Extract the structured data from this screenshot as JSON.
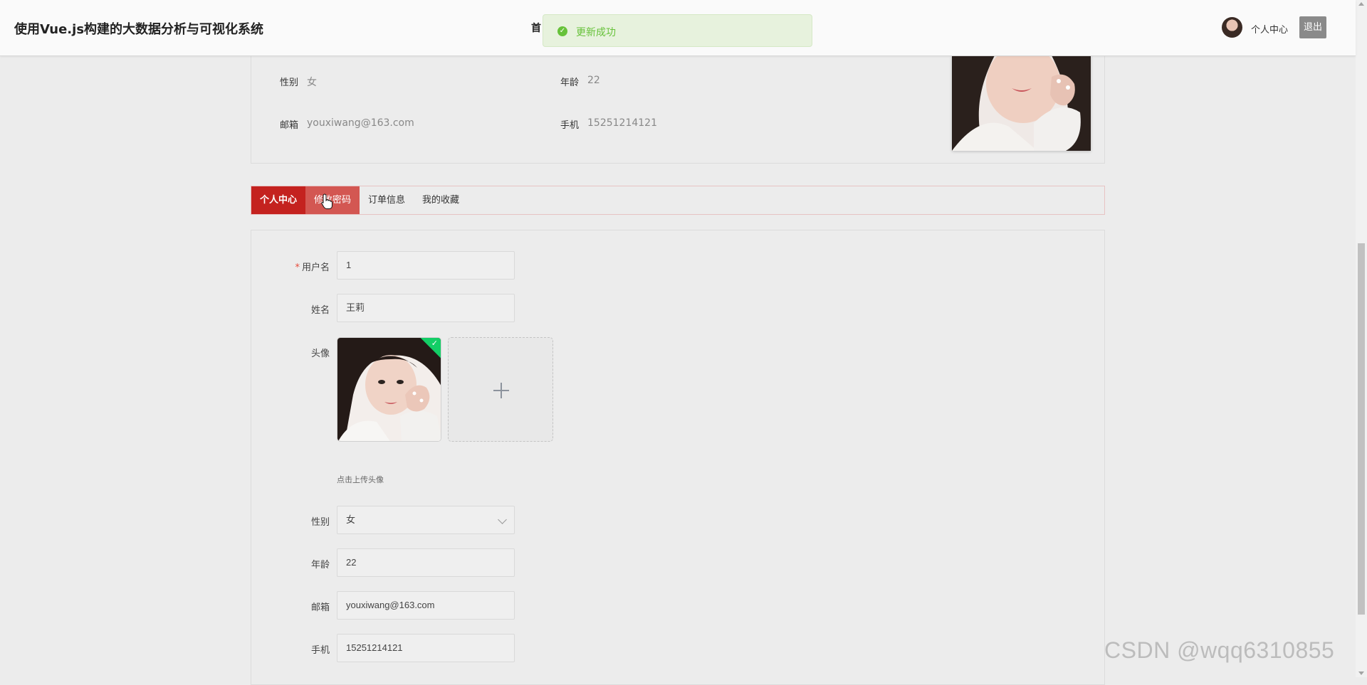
{
  "header": {
    "title": "使用Vue.js构建的大数据分析与可视化系统",
    "nav_home": "首",
    "user_label": "个人中心",
    "logout_label": "退出"
  },
  "toast": {
    "text": "更新成功"
  },
  "summary": {
    "gender_label": "性别",
    "gender_value": "女",
    "age_label": "年龄",
    "age_value": "22",
    "email_label": "邮箱",
    "email_value": "youxiwang@163.com",
    "phone_label": "手机",
    "phone_value": "15251214121"
  },
  "tabs": [
    {
      "label": "个人中心",
      "state": "active"
    },
    {
      "label": "修改密码",
      "state": "hover"
    },
    {
      "label": "订单信息",
      "state": "normal"
    },
    {
      "label": "我的收藏",
      "state": "normal"
    }
  ],
  "form": {
    "username": {
      "label": "用户名",
      "required_mark": "*",
      "value": "1"
    },
    "name": {
      "label": "姓名",
      "value": "王莉"
    },
    "avatar": {
      "label": "头像",
      "hint": "点击上传头像"
    },
    "gender": {
      "label": "性别",
      "value": "女"
    },
    "age": {
      "label": "年龄",
      "value": "22"
    },
    "email": {
      "label": "邮箱",
      "value": "youxiwang@163.com"
    },
    "phone": {
      "label": "手机",
      "value": "15251214121"
    }
  },
  "watermark": "CSDN @wqq6310855",
  "colors": {
    "tab_active": "#c4221f",
    "tab_hover": "#d35752",
    "toast_success": "#67c23a",
    "upload_success": "#13ce66"
  }
}
